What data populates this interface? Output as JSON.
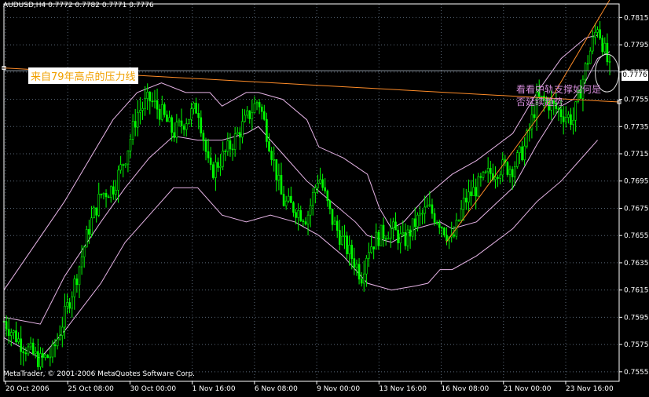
{
  "header": {
    "symbol": "AUDUSD,H4",
    "open": "0.7772",
    "high": "0.7782",
    "low": "0.7771",
    "close": "0.7776"
  },
  "copyright": "MetaTrader, © 2001-2006 MetaQuotes Software Corp.",
  "annotations": {
    "resistance": "来自79年高点的压力线",
    "support": "看看中轨支撑如何是否延续趋势"
  },
  "current_price_label": "0.7776",
  "colors": {
    "background": "#000000",
    "candles": "#00ff00",
    "bands": "#e6b4e6",
    "trendlines": "#ff8c28",
    "text": "#ffffff",
    "annotation_resistance": "#f0a000",
    "annotation_support": "#d38bd9"
  },
  "chart_data": {
    "type": "candlestick",
    "indicator": "Bollinger Bands",
    "ylim": [
      0.7548,
      0.7825
    ],
    "y_ticks": [
      "0.7815",
      "0.7795",
      "0.7775",
      "0.7755",
      "0.7735",
      "0.7715",
      "0.7695",
      "0.7675",
      "0.7655",
      "0.7635",
      "0.7615",
      "0.7595",
      "0.7575",
      "0.7555"
    ],
    "x_ticks": [
      "20 Oct 2006",
      "25 Oct 08:00",
      "30 Oct 00:00",
      "1 Nov 16:00",
      "6 Nov 08:00",
      "9 Nov 00:00",
      "13 Nov 16:00",
      "16 Nov 08:00",
      "21 Nov 00:00",
      "23 Nov 16:00"
    ],
    "close_path": [
      [
        0,
        0.7592
      ],
      [
        3,
        0.7575
      ],
      [
        6,
        0.7563
      ],
      [
        8,
        0.7568
      ],
      [
        10,
        0.7596
      ],
      [
        12,
        0.7625
      ],
      [
        14,
        0.766
      ],
      [
        16,
        0.7685
      ],
      [
        18,
        0.769
      ],
      [
        20,
        0.7712
      ],
      [
        22,
        0.7745
      ],
      [
        24,
        0.7755
      ],
      [
        26,
        0.7745
      ],
      [
        28,
        0.773
      ],
      [
        30,
        0.774
      ],
      [
        32,
        0.775
      ],
      [
        34,
        0.77
      ],
      [
        36,
        0.7712
      ],
      [
        38,
        0.7725
      ],
      [
        40,
        0.774
      ],
      [
        42,
        0.7755
      ],
      [
        44,
        0.772
      ],
      [
        46,
        0.768
      ],
      [
        48,
        0.7675
      ],
      [
        50,
        0.7668
      ],
      [
        52,
        0.77
      ],
      [
        54,
        0.7668
      ],
      [
        56,
        0.765
      ],
      [
        58,
        0.7635
      ],
      [
        59,
        0.7625
      ],
      [
        60,
        0.7645
      ],
      [
        62,
        0.7655
      ],
      [
        64,
        0.766
      ],
      [
        66,
        0.765
      ],
      [
        68,
        0.7665
      ],
      [
        70,
        0.7675
      ],
      [
        72,
        0.7665
      ],
      [
        74,
        0.765
      ],
      [
        76,
        0.768
      ],
      [
        78,
        0.769
      ],
      [
        80,
        0.77
      ],
      [
        82,
        0.7705
      ],
      [
        84,
        0.7705
      ],
      [
        86,
        0.772
      ],
      [
        88,
        0.7755
      ],
      [
        90,
        0.7752
      ],
      [
        92,
        0.7745
      ],
      [
        94,
        0.774
      ],
      [
        96,
        0.7778
      ],
      [
        98,
        0.781
      ],
      [
        100,
        0.7776
      ]
    ],
    "bollinger_upper": [
      [
        0,
        0.7615
      ],
      [
        10,
        0.768
      ],
      [
        18,
        0.774
      ],
      [
        22,
        0.776
      ],
      [
        26,
        0.7767
      ],
      [
        30,
        0.776
      ],
      [
        34,
        0.776
      ],
      [
        36,
        0.775
      ],
      [
        40,
        0.776
      ],
      [
        42,
        0.776
      ],
      [
        46,
        0.7755
      ],
      [
        50,
        0.774
      ],
      [
        52,
        0.772
      ],
      [
        56,
        0.7712
      ],
      [
        60,
        0.77
      ],
      [
        62,
        0.7675
      ],
      [
        64,
        0.766
      ],
      [
        66,
        0.7665
      ],
      [
        70,
        0.7685
      ],
      [
        74,
        0.77
      ],
      [
        78,
        0.771
      ],
      [
        84,
        0.773
      ],
      [
        88,
        0.776
      ],
      [
        92,
        0.7785
      ],
      [
        96,
        0.78
      ],
      [
        98,
        0.7802
      ]
    ],
    "bollinger_middle": [
      [
        0,
        0.7595
      ],
      [
        6,
        0.759
      ],
      [
        10,
        0.7625
      ],
      [
        16,
        0.7665
      ],
      [
        20,
        0.769
      ],
      [
        24,
        0.7712
      ],
      [
        28,
        0.7728
      ],
      [
        32,
        0.7725
      ],
      [
        36,
        0.7725
      ],
      [
        40,
        0.773
      ],
      [
        42,
        0.7735
      ],
      [
        46,
        0.7715
      ],
      [
        50,
        0.7695
      ],
      [
        54,
        0.768
      ],
      [
        58,
        0.7665
      ],
      [
        60,
        0.7655
      ],
      [
        64,
        0.765
      ],
      [
        68,
        0.766
      ],
      [
        72,
        0.7665
      ],
      [
        74,
        0.766
      ],
      [
        78,
        0.7665
      ],
      [
        84,
        0.769
      ],
      [
        88,
        0.7722
      ],
      [
        92,
        0.775
      ],
      [
        94,
        0.7755
      ],
      [
        96,
        0.7768
      ],
      [
        98,
        0.7785
      ],
      [
        100,
        0.779
      ]
    ],
    "bollinger_lower": [
      [
        0,
        0.758
      ],
      [
        6,
        0.7565
      ],
      [
        10,
        0.7585
      ],
      [
        16,
        0.762
      ],
      [
        20,
        0.765
      ],
      [
        24,
        0.767
      ],
      [
        28,
        0.769
      ],
      [
        32,
        0.769
      ],
      [
        36,
        0.767
      ],
      [
        40,
        0.7665
      ],
      [
        44,
        0.767
      ],
      [
        48,
        0.7665
      ],
      [
        52,
        0.7655
      ],
      [
        56,
        0.764
      ],
      [
        60,
        0.762
      ],
      [
        64,
        0.7615
      ],
      [
        68,
        0.7618
      ],
      [
        70,
        0.762
      ],
      [
        72,
        0.763
      ],
      [
        74,
        0.763
      ],
      [
        78,
        0.764
      ],
      [
        84,
        0.766
      ],
      [
        88,
        0.768
      ],
      [
        92,
        0.7695
      ],
      [
        96,
        0.7715
      ],
      [
        98,
        0.7725
      ]
    ],
    "trendline_resistance": [
      [
        0,
        0.7778
      ],
      [
        100,
        0.7753
      ]
    ],
    "trendline_support": [
      [
        73,
        0.765
      ],
      [
        90,
        0.7753
      ],
      [
        100,
        0.7828
      ]
    ],
    "highlight_circle": {
      "x": 98,
      "y": 0.778
    }
  }
}
